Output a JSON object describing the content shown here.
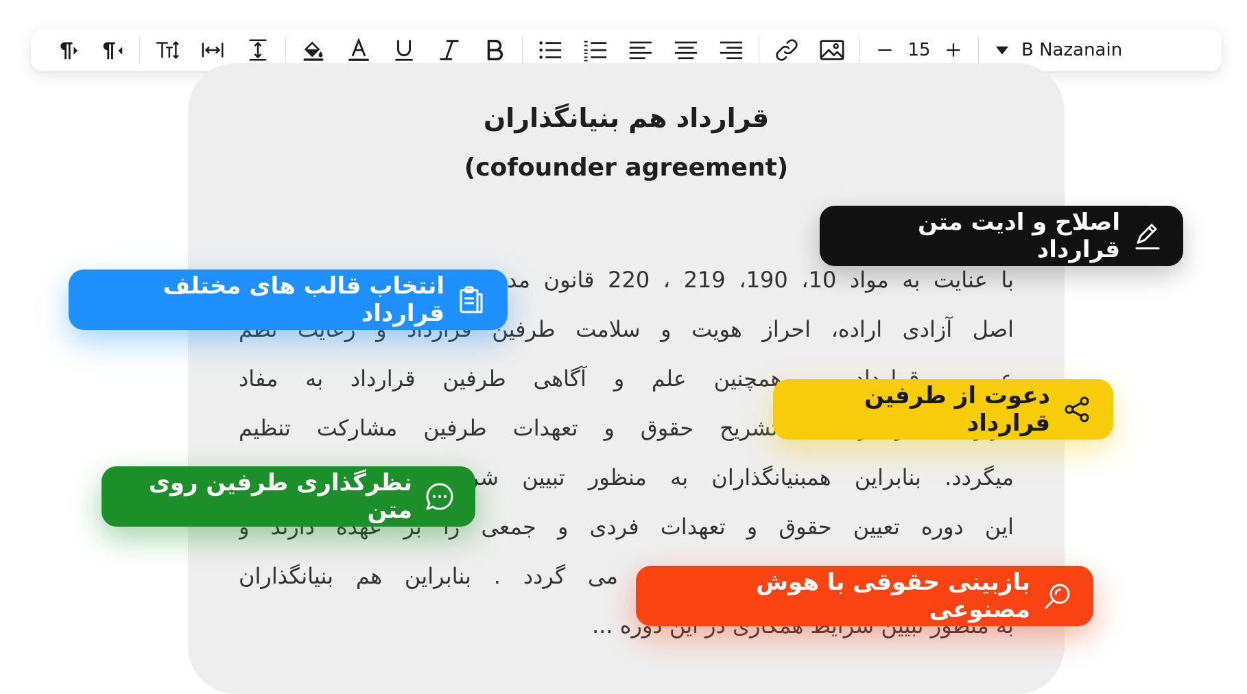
{
  "toolbar": {
    "font_size": "15",
    "font_name": "B Nazanain",
    "icons": [
      "paragraph-ltr-icon",
      "paragraph-rtl-icon",
      "text-size-icon",
      "letter-spacing-icon",
      "line-height-icon",
      "fill-color-icon",
      "text-color-icon",
      "underline-icon",
      "italic-icon",
      "bold-icon",
      "bullet-list-icon",
      "numbered-list-icon",
      "align-left-icon",
      "align-center-icon",
      "align-right-icon",
      "link-icon",
      "image-icon",
      "minus-icon",
      "plus-icon",
      "caret-down-icon"
    ]
  },
  "document": {
    "title": "قرارداد هم بنیانگذاران",
    "subtitle": "(cofounder agreement)",
    "body_lines": [
      "با عنایت به مواد 10، 190، 219 ، 220 قانون مدنی، قرارداد حاضر بر مبنای",
      "اصل آزادی اراده، احراز هویت و سلامت طرفین قرارداد و رعایت نظم",
      "عمومی قرارداد، و همچنین علم و آگاهی طرفین قرارداد به مفاد",
      "قرارداد، در راستای تشریح حقوق و تعهدات طرفین مشارکت تنظیم",
      "میگردد. بنابراین همبنیانگذاران به منظور تبیین شرایط همکاری خود در",
      "این دوره تعیین حقوق و تعهدات فردی و جمعی را بر عهده دارند و",
      "قابلیت تفسیر و تنفیذ این قرارداد می گردد . بنابراین هم بنیانگذاران",
      "به منظور تبیین شرایط همکاری در این دوره ..."
    ]
  },
  "badges": {
    "edit": "اصلاح و ادیت متن قرارداد",
    "template": "انتخاب قالب های مختلف قرارداد",
    "invite": "دعوت از طرفین قرارداد",
    "comment": "نظرگذاری طرفین روی متن",
    "ai_review": "بازبینی حقوقی با هوش مصنوعی"
  },
  "colors": {
    "edit": "#111111",
    "template": "#1f8ffb",
    "invite": "#f6cc0b",
    "comment": "#1c8e2a",
    "ai_review": "#fa4313",
    "document_bg": "#eeeeee"
  }
}
